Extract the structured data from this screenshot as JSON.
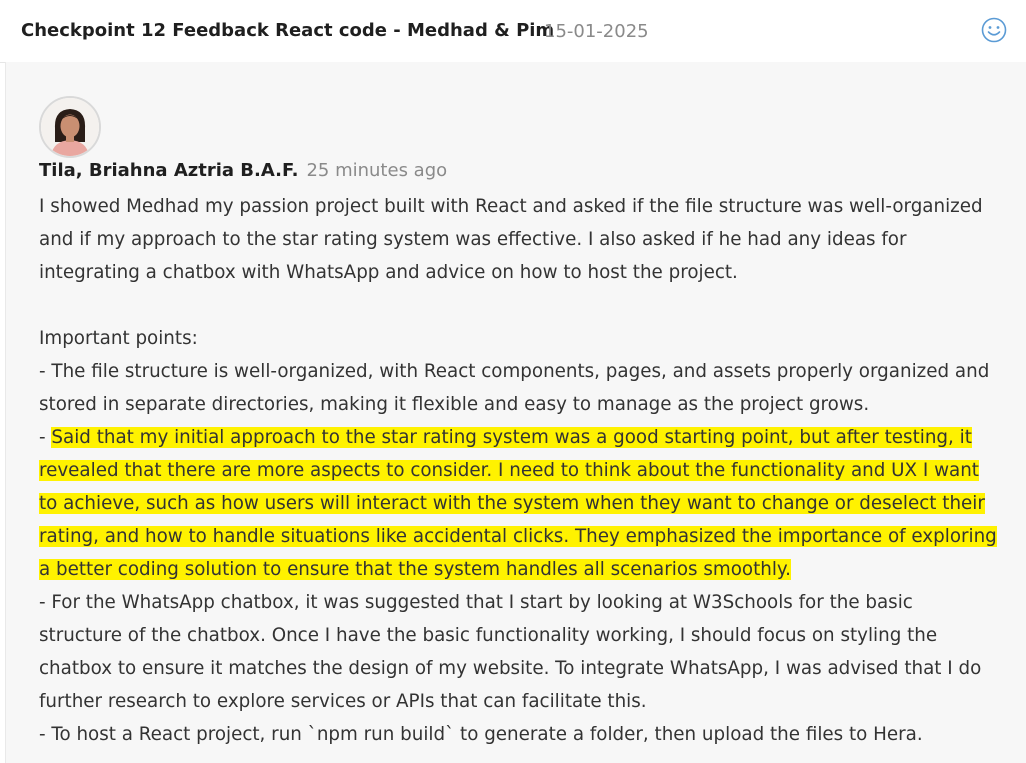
{
  "header": {
    "title": "Checkpoint 12  Feedback React code - Medhad & Pim",
    "date": "15-01-2025",
    "emoji_icon": "smiley-icon"
  },
  "comment": {
    "author": "Tila, Briahna Aztria B.A.F.",
    "time": "25 minutes ago",
    "lines": [
      "I showed Medhad my passion project built with React and asked if the file structure was well-organized",
      "and if my approach to the star rating system was effective. I also asked if he had any ideas for",
      "integrating a chatbox with WhatsApp and advice on how to host the project.",
      "",
      "Important points:",
      "- The file structure is well-organized, with React components, pages, and assets properly organized and",
      "stored in separate directories, making it flexible and easy to manage as the project grows."
    ],
    "highlight_prefix": "- ",
    "highlight_lines": [
      "Said that my initial approach to the star rating system was a good starting point, but after testing, it",
      "revealed that there are more aspects to consider. I need to think about the functionality and UX I want",
      "to achieve, such as how users will interact with the system when they want to change or deselect their",
      "rating, and how to handle situations like accidental clicks. They emphasized the importance of exploring",
      "a better coding solution to ensure that the system handles all scenarios smoothly."
    ],
    "tail_lines": [
      "- For the WhatsApp chatbox, it was suggested that I start by looking at W3Schools for the basic",
      "structure of the chatbox. Once I have the basic functionality working, I should focus on styling the",
      "chatbox to ensure it matches the design of my website. To integrate WhatsApp, I was advised that I do",
      "further research to explore services or APIs that can facilitate this.",
      "- To host a React project, run `npm run build` to generate a folder, then upload the files to Hera."
    ]
  },
  "colors": {
    "highlight": "#fff200",
    "accent_icon": "#5b9bd5"
  }
}
